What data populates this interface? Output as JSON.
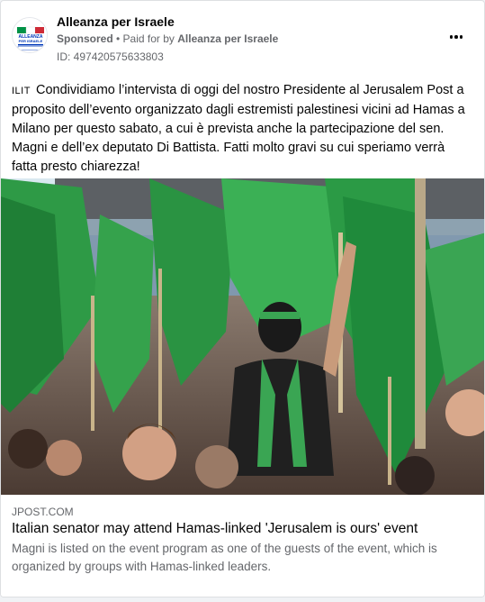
{
  "advertiser": {
    "name": "Alleanza per Israele",
    "logo_text_top": "ALLEANZA",
    "logo_text_bottom": "PER ISRAELE"
  },
  "meta": {
    "sponsored_label": "Sponsored",
    "separator": " • ",
    "paid_for_by_label": "Paid for by ",
    "payer": "Alleanza per Israele",
    "ad_id": "ID: 497420575633803"
  },
  "post": {
    "flag_code": "ILIT",
    "text": "Condividiamo l’intervista di oggi del nostro Presidente al Jerusalem Post a proposito dell’evento organizzato dagli estremisti palestinesi vicini ad Hamas a Milano per questo sabato, a cui è prevista anche la partecipazione del sen. Magni e dell’ex deputato Di Battista. Fatti molto gravi su cui speriamo verrà fatta presto chiarezza!"
  },
  "link": {
    "domain": "JPOST.COM",
    "title": "Italian senator may attend Hamas-linked 'Jerusalem is ours' event",
    "description": "Magni is listed on the event program as one of the guests of the event, which is organized by groups with Hamas-linked leaders."
  },
  "icons": {
    "more": "more-options-icon"
  },
  "colors": {
    "card_bg": "#ffffff",
    "text_primary": "#050505",
    "text_secondary": "#65676b",
    "flag_green": "#2a9d3a"
  }
}
